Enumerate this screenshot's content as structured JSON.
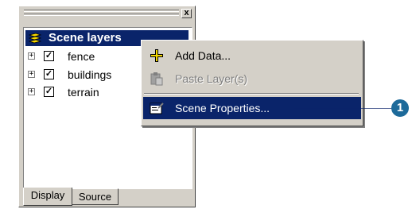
{
  "panel": {
    "close_glyph": "x",
    "root_label": "Scene layers",
    "layers": [
      {
        "label": "fence",
        "expander": "+",
        "checked": true
      },
      {
        "label": "buildings",
        "expander": "+",
        "checked": true
      },
      {
        "label": "terrain",
        "expander": "+",
        "checked": true
      }
    ],
    "tabs": [
      {
        "label": "Display",
        "active": true
      },
      {
        "label": "Source",
        "active": false
      }
    ]
  },
  "context_menu": {
    "items": [
      {
        "label": "Add Data...",
        "icon": "add-data-icon",
        "enabled": true
      },
      {
        "label": "Paste Layer(s)",
        "icon": "paste-icon",
        "enabled": false
      },
      {
        "label": "Scene Properties...",
        "icon": "properties-icon",
        "enabled": true,
        "highlighted": true
      }
    ]
  },
  "callout": {
    "number": "1"
  },
  "colors": {
    "selection": "#0a246a",
    "face": "#d4d0c8",
    "callout": "#1d6a9a"
  }
}
